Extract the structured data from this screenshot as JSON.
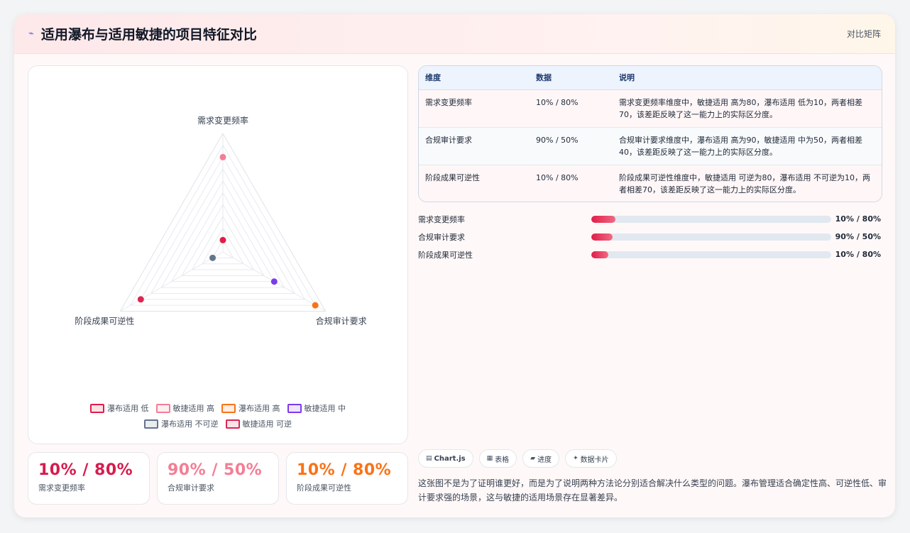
{
  "header": {
    "title": "适用瀑布与适用敏捷的项目特征对比",
    "tag": "对比矩阵",
    "icon": "sparkle-icon"
  },
  "chart_data": {
    "type": "radar",
    "axes": [
      "需求变更频率",
      "合规审计要求",
      "阶段成果可逆性"
    ],
    "rlim": [
      0,
      100
    ],
    "series": [
      {
        "name": "瀑布适用 低",
        "axis": "需求变更频率",
        "value": 10,
        "color": "#e11d48"
      },
      {
        "name": "敏捷适用 高",
        "axis": "需求变更频率",
        "value": 80,
        "color": "#f37e95"
      },
      {
        "name": "瀑布适用 高",
        "axis": "合规审计要求",
        "value": 90,
        "color": "#f97316"
      },
      {
        "name": "敏捷适用 中",
        "axis": "合规审计要求",
        "value": 50,
        "color": "#7c3aed"
      },
      {
        "name": "瀑布适用 不可逆",
        "axis": "阶段成果可逆性",
        "value": 10,
        "color": "#64748b"
      },
      {
        "name": "敏捷适用 可逆",
        "axis": "阶段成果可逆性",
        "value": 80,
        "color": "#dc2650"
      }
    ]
  },
  "stats": [
    {
      "value": "10% / 80%",
      "label": "需求变更频率",
      "color": "#d61c4e"
    },
    {
      "value": "90% / 50%",
      "label": "合规审计要求",
      "color": "#f37e95"
    },
    {
      "value": "10% / 80%",
      "label": "阶段成果可逆性",
      "color": "#f97316"
    }
  ],
  "table": {
    "headers": [
      "维度",
      "数据",
      "说明"
    ],
    "rows": [
      [
        "需求变更频率",
        "10% / 80%",
        "需求变更频率维度中，敏捷适用 高为80，瀑布适用 低为10，两者相差70，该差距反映了这一能力上的实际区分度。"
      ],
      [
        "合规审计要求",
        "90% / 50%",
        "合规审计要求维度中，瀑布适用 高为90，敏捷适用 中为50，两者相差40，该差距反映了这一能力上的实际区分度。"
      ],
      [
        "阶段成果可逆性",
        "10% / 80%",
        "阶段成果可逆性维度中，敏捷适用 可逆为80，瀑布适用 不可逆为10，两者相差70，该差距反映了这一能力上的实际区分度。"
      ]
    ]
  },
  "bars": [
    {
      "label": "需求变更频率",
      "value_text": "10% / 80%",
      "fill": 0.1
    },
    {
      "label": "合规审计要求",
      "value_text": "90% / 50%",
      "fill": 0.09
    },
    {
      "label": "阶段成果可逆性",
      "value_text": "10% / 80%",
      "fill": 0.07
    }
  ],
  "tags": [
    {
      "icon": "chart-icon",
      "glyph": "▤",
      "label": "Chart.js"
    },
    {
      "icon": "table-icon",
      "glyph": "▦",
      "label": "表格"
    },
    {
      "icon": "progress-icon",
      "glyph": "▰",
      "label": "进度"
    },
    {
      "icon": "datacard-icon",
      "glyph": "✦",
      "label": "数据卡片"
    }
  ],
  "note": "这张图不是为了证明谁更好，而是为了说明两种方法论分别适合解决什么类型的问题。瀑布管理适合确定性高、可逆性低、审计要求强的场景，这与敏捷的适用场景存在显著差异。"
}
